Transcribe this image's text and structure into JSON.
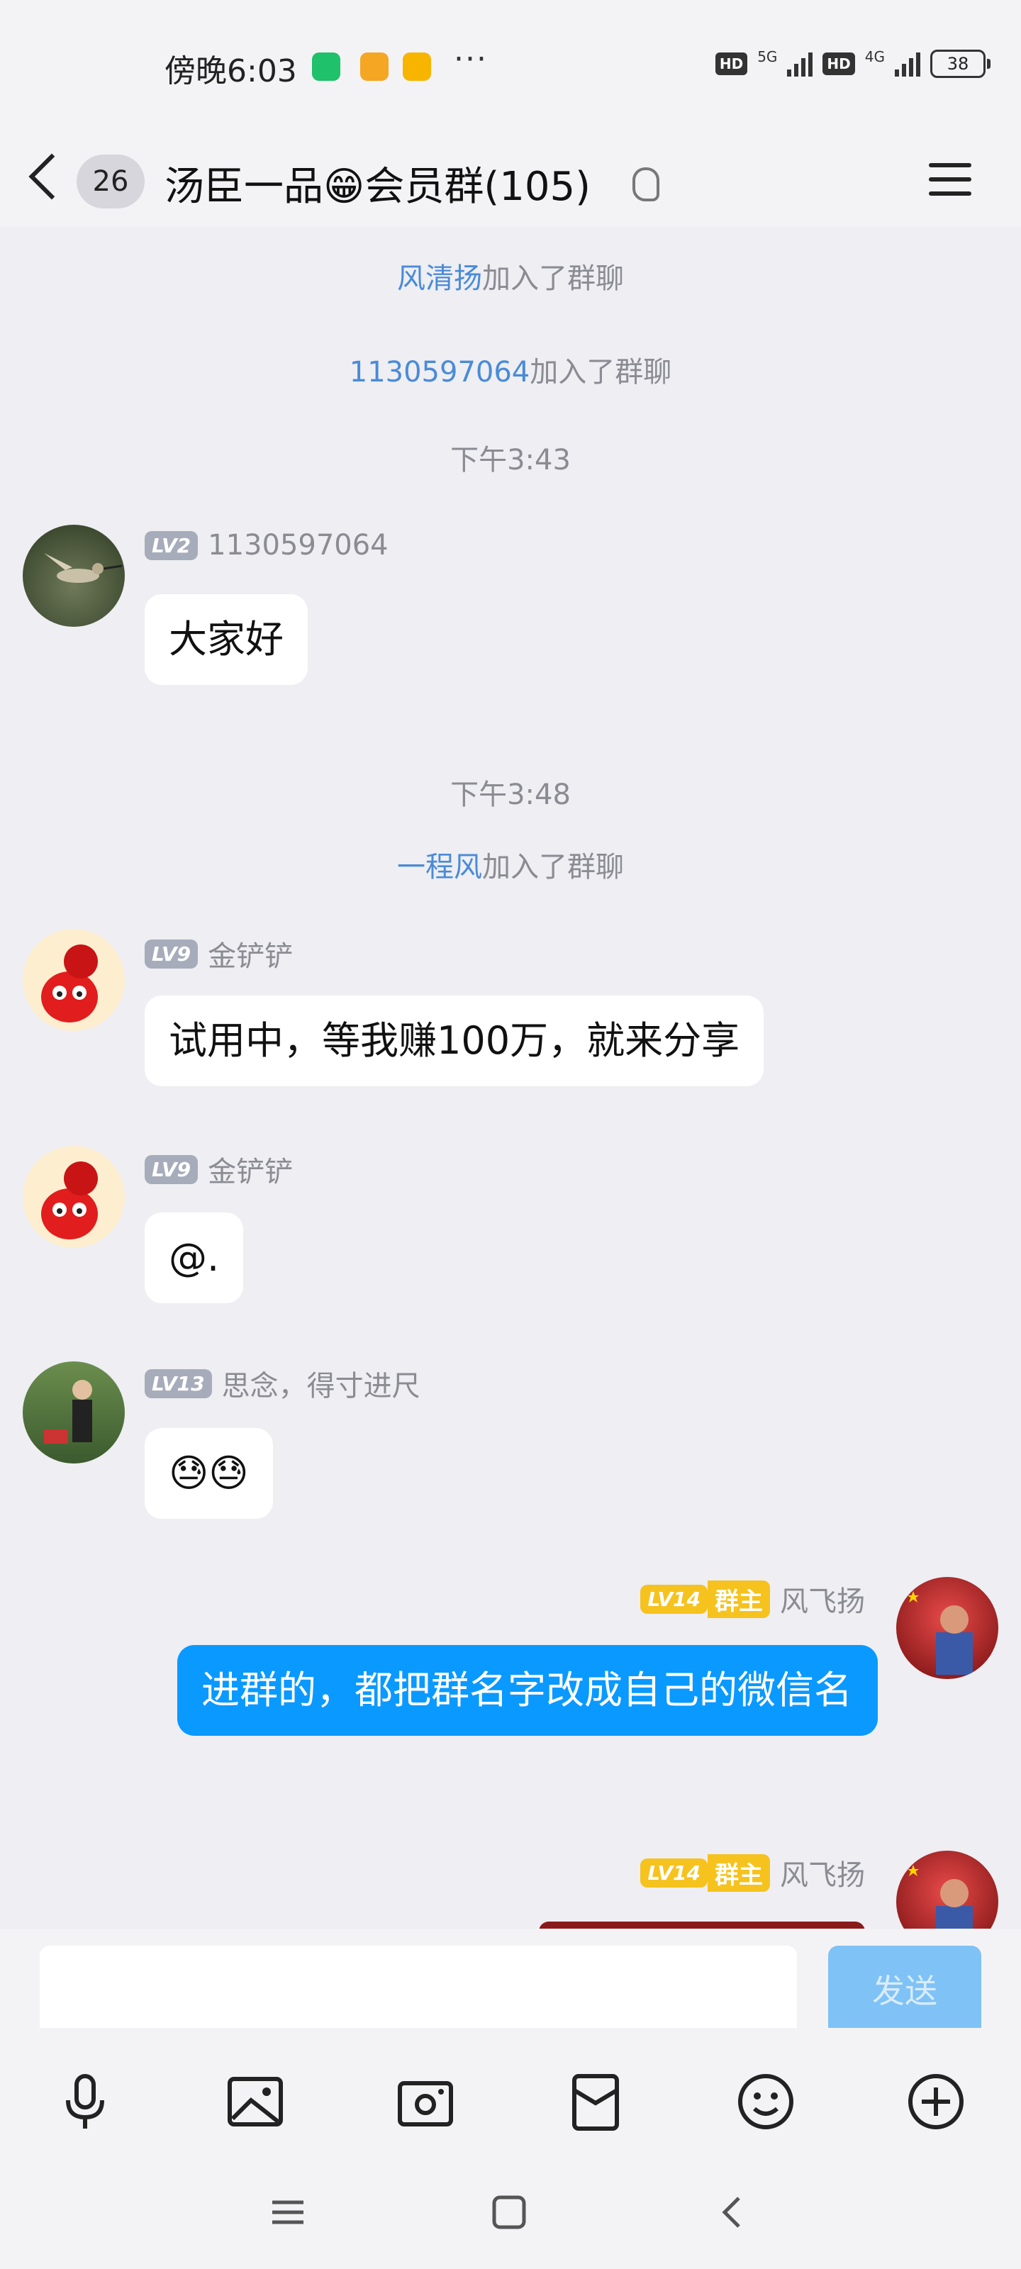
{
  "status_bar": {
    "time": "傍晚6:03",
    "more": "···",
    "hd": "HD",
    "network_1": "5G",
    "network_2": "4G",
    "battery": "38"
  },
  "header": {
    "back_count": "26",
    "title": "汤臣一品😁会员群(105)"
  },
  "system_messages": [
    {
      "name": "风清扬",
      "suffix": "加入了群聊"
    },
    {
      "name": "1130597064",
      "suffix": "加入了群聊"
    },
    {
      "name": "一程风",
      "suffix": "加入了群聊"
    }
  ],
  "timestamps": [
    "下午3:43",
    "下午3:48"
  ],
  "messages": [
    {
      "level": "LV2",
      "sender": "1130597064",
      "text": "大家好"
    },
    {
      "level": "LV9",
      "sender": "金铲铲",
      "text": "试用中，等我赚100万，就来分享"
    },
    {
      "level": "LV9",
      "sender": "金铲铲",
      "text": "@."
    },
    {
      "level": "LV13",
      "sender": "思念，得寸进尺",
      "text": "😓😓"
    },
    {
      "level": "LV14",
      "role": "群主",
      "sender": "风飞扬",
      "text": "进群的，都把群名字改成自己的微信名"
    },
    {
      "level": "LV14",
      "role": "群主",
      "sender": "风飞扬",
      "text": ""
    }
  ],
  "input": {
    "placeholder": "",
    "send_label": "发送"
  },
  "toolbar": [
    "voice",
    "photo",
    "camera",
    "red-packet",
    "emoji",
    "plus"
  ],
  "colors": {
    "accent": "#0a99ff",
    "link": "#4a8bd6",
    "owner_badge": "#f6c21e"
  }
}
